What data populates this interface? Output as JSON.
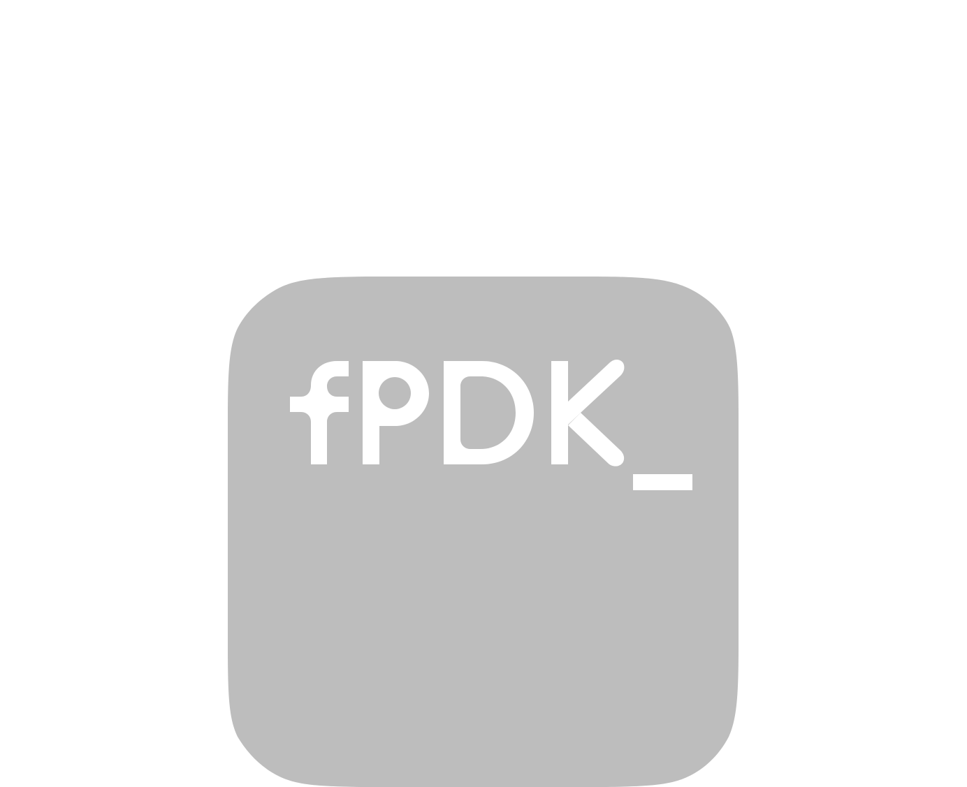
{
  "logo": {
    "text": "fPDK_",
    "background_color": "#bdbdbd",
    "foreground_color": "#ffffff",
    "page_background": "#ffffff"
  }
}
